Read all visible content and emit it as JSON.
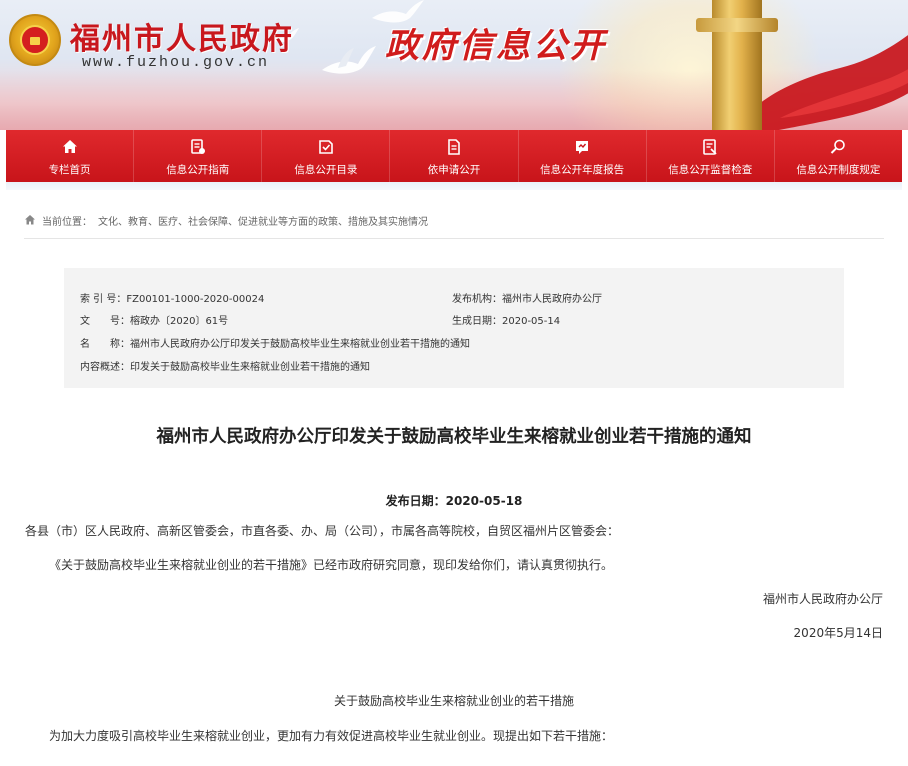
{
  "header": {
    "site_name": "福州市人民政府",
    "site_url": "www.fuzhou.gov.cn",
    "slogan": "政府信息公开"
  },
  "nav": {
    "items": [
      {
        "label": "专栏首页",
        "icon": "home-icon"
      },
      {
        "label": "信息公开指南",
        "icon": "guide-icon"
      },
      {
        "label": "信息公开目录",
        "icon": "catalog-icon"
      },
      {
        "label": "依申请公开",
        "icon": "document-icon"
      },
      {
        "label": "信息公开年度报告",
        "icon": "report-icon"
      },
      {
        "label": "信息公开监督检查",
        "icon": "supervision-icon"
      },
      {
        "label": "信息公开制度规定",
        "icon": "regulation-icon"
      }
    ]
  },
  "breadcrumb": {
    "prefix": "当前位置：",
    "path": "文化、教育、医疗、社会保障、促进就业等方面的政策、措施及其实施情况"
  },
  "meta": {
    "index_label": "索 引 号：",
    "index_value": "FZ00101-1000-2020-00024",
    "issuer_label": "发布机构：",
    "issuer_value": "福州市人民政府办公厅",
    "doc_no_label": "文　　号：",
    "doc_no_value": "榕政办〔2020〕61号",
    "gen_date_label": "生成日期：",
    "gen_date_value": "2020-05-14",
    "name_label": "名　　称：",
    "name_value": "福州市人民政府办公厅印发关于鼓励高校毕业生来榕就业创业若干措施的通知",
    "summary_label": "内容概述：",
    "summary_value": "印发关于鼓励高校毕业生来榕就业创业若干措施的通知"
  },
  "article": {
    "title": "福州市人民政府办公厅印发关于鼓励高校毕业生来榕就业创业若干措施的通知",
    "publish_date": "发布日期：2020-05-18",
    "addressee": "各县（市）区人民政府、高新区管委会，市直各委、办、局（公司），市属各高等院校，自贸区福州片区管委会：",
    "body_1": "《关于鼓励高校毕业生来榕就业创业的若干措施》已经市政府研究同意，现印发给你们，请认真贯彻执行。",
    "signature": "福州市人民政府办公厅",
    "sign_date": "2020年5月14日",
    "section_title": "关于鼓励高校毕业生来榕就业创业的若干措施",
    "intro": "为加大力度吸引高校毕业生来榕就业创业，更加有力有效促进高校毕业生就业创业。现提出如下若干措施："
  },
  "colors": {
    "brand_red": "#c8141a",
    "nav_red": "#e0292d"
  }
}
